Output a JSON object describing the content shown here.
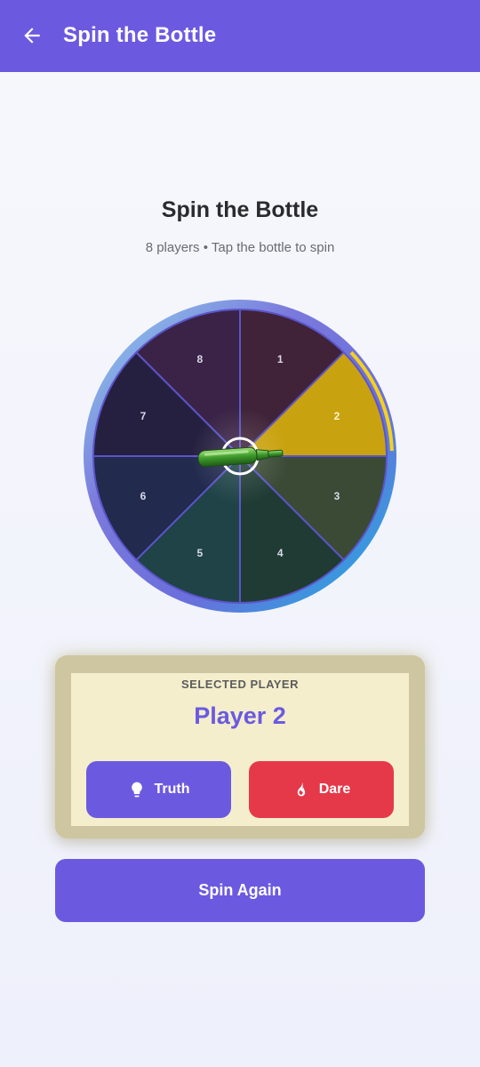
{
  "appbar": {
    "title": "Spin the Bottle",
    "back_icon": "arrow-left-icon"
  },
  "game": {
    "title": "Spin the Bottle",
    "subtitle": "8 players • Tap the bottle to spin",
    "players": [
      "1",
      "2",
      "3",
      "4",
      "5",
      "6",
      "7",
      "8"
    ],
    "selected_index": 1
  },
  "result": {
    "label": "SELECTED PLAYER",
    "player": "Player 2",
    "truth_label": "Truth",
    "truth_icon": "lightbulb-icon",
    "dare_label": "Dare",
    "dare_icon": "fire-icon"
  },
  "spin_again_label": "Spin Again",
  "colors": {
    "primary": "#6b5ae0",
    "dare": "#e5394a",
    "highlight": "#c9a20f"
  }
}
